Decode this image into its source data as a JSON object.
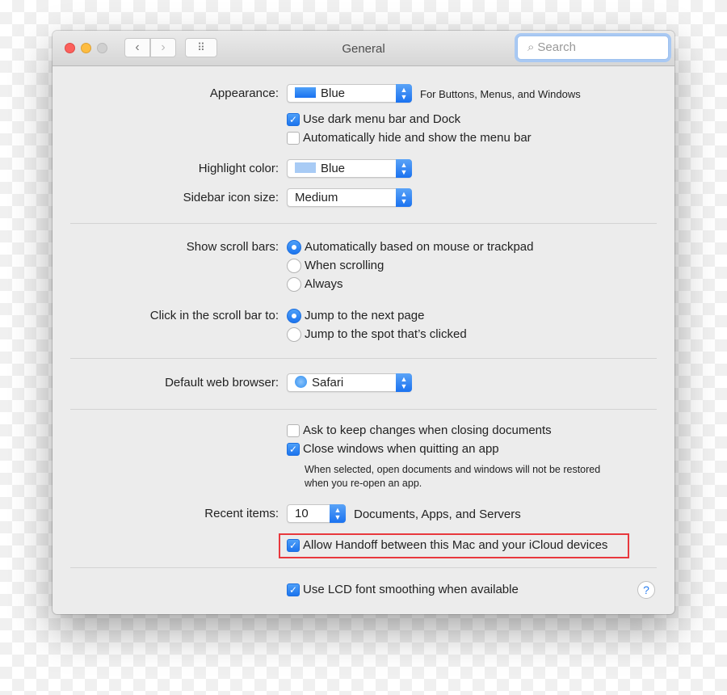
{
  "window": {
    "title": "General",
    "search_placeholder": "Search",
    "back": "‹",
    "forward": "›",
    "grid": "⠿"
  },
  "appearance": {
    "label": "Appearance:",
    "value": "Blue",
    "color": "#1a72f0",
    "note": "For Buttons, Menus, and Windows"
  },
  "dark_menu": {
    "label": "Use dark menu bar and Dock",
    "checked": true
  },
  "auto_hide": {
    "label": "Automatically hide and show the menu bar",
    "checked": false
  },
  "highlight": {
    "label": "Highlight color:",
    "value": "Blue",
    "color": "#a8cbf5"
  },
  "sidebar_size": {
    "label": "Sidebar icon size:",
    "value": "Medium"
  },
  "scroll_bars": {
    "label": "Show scroll bars:",
    "options": [
      "Automatically based on mouse or trackpad",
      "When scrolling",
      "Always"
    ],
    "selected": 0
  },
  "click_scroll": {
    "label": "Click in the scroll bar to:",
    "options": [
      "Jump to the next page",
      "Jump to the spot that’s clicked"
    ],
    "selected": 0
  },
  "browser": {
    "label": "Default web browser:",
    "value": "Safari"
  },
  "ask_keep": {
    "label": "Ask to keep changes when closing documents",
    "checked": false
  },
  "close_windows": {
    "label": "Close windows when quitting an app",
    "checked": true,
    "note_line1": "When selected, open documents and windows will not be restored",
    "note_line2": "when you re-open an app."
  },
  "recent": {
    "label": "Recent items:",
    "value": "10",
    "suffix": "Documents, Apps, and Servers"
  },
  "handoff": {
    "label": "Allow Handoff between this Mac and your iCloud devices",
    "checked": true,
    "highlight_color": "#e8383d"
  },
  "lcd": {
    "label": "Use LCD font smoothing when available",
    "checked": true
  },
  "help": "?"
}
